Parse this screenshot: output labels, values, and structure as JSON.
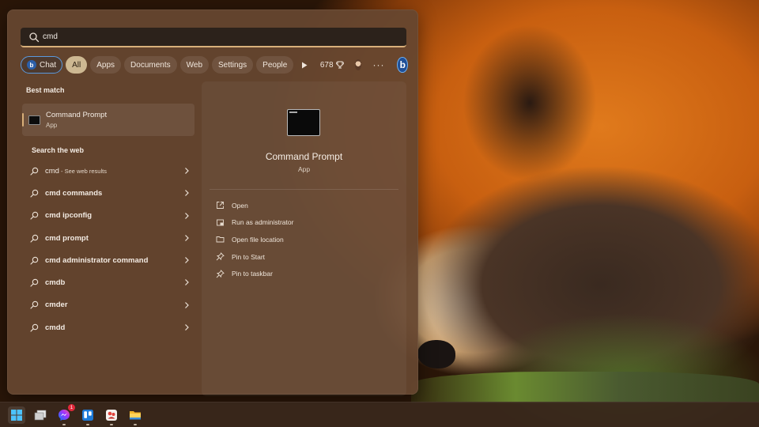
{
  "search": {
    "value": "cmd",
    "placeholder": ""
  },
  "filters": {
    "chat": "Chat",
    "all": "All",
    "apps": "Apps",
    "documents": "Documents",
    "web": "Web",
    "settings": "Settings",
    "people": "People",
    "points": "678",
    "more": "···"
  },
  "best_match": {
    "title": "Best match",
    "name": "Command Prompt",
    "type": "App"
  },
  "web": {
    "title": "Search the web",
    "items": [
      {
        "bold": "cmd",
        "hint": " - See web results"
      },
      {
        "bold": "cmd commands",
        "hint": ""
      },
      {
        "bold": "cmd ipconfig",
        "hint": ""
      },
      {
        "bold": "cmd prompt",
        "hint": ""
      },
      {
        "bold": "cmd administrator command",
        "hint": ""
      },
      {
        "bold": "cmdb",
        "hint": ""
      },
      {
        "bold": "cmder",
        "hint": ""
      },
      {
        "bold": "cmdd",
        "hint": ""
      }
    ]
  },
  "details": {
    "name": "Command Prompt",
    "type": "App",
    "actions": [
      {
        "label": "Open",
        "icon": "open-icon"
      },
      {
        "label": "Run as administrator",
        "icon": "shield-icon"
      },
      {
        "label": "Open file location",
        "icon": "folder-icon"
      },
      {
        "label": "Pin to Start",
        "icon": "pin-icon"
      },
      {
        "label": "Pin to taskbar",
        "icon": "pin-icon"
      }
    ]
  },
  "colors": {
    "accent": "#d9b07a",
    "panel": "#664630",
    "bing": "#1f4f97"
  },
  "taskbar": {
    "messenger_badge": "1"
  }
}
